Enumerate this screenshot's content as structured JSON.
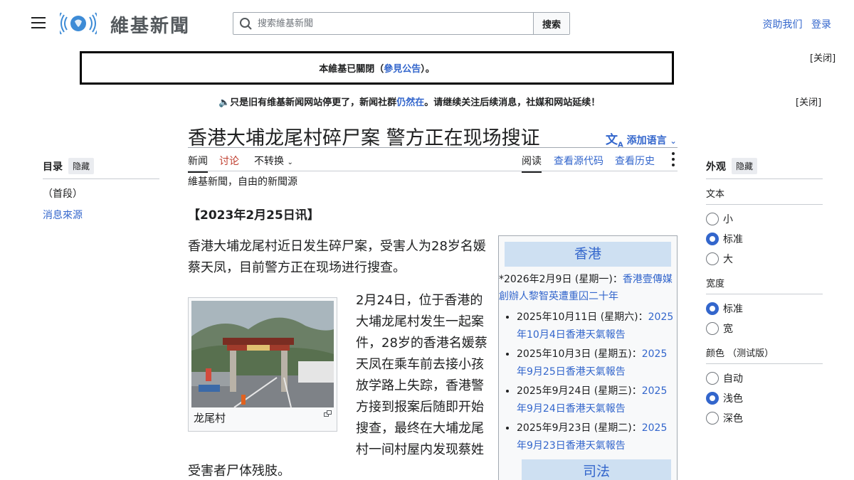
{
  "header": {
    "wordmark": "維基新聞",
    "search_placeholder": "搜索維基新聞",
    "search_button": "搜索",
    "donate": "资助我们",
    "login": "登录"
  },
  "notices": {
    "closed_pre": "本維基已關閉（",
    "closed_link": "參見公告",
    "closed_post": "）。",
    "close1": "[关闭]",
    "notice2_pre": "🔈只是旧有维基新闻网站停更了，新闻社群",
    "notice2_link": "仍然在",
    "notice2_post": "。请继续关注后续消息，社媒和网站延续！",
    "close2": "[关闭]"
  },
  "article": {
    "title": "香港大埔龙尾村碎尸案 警方正在现场搜证",
    "add_language": "添加语言",
    "tabs": {
      "news": "新闻",
      "talk": "讨论",
      "variant": "不转换",
      "read": "阅读",
      "view_source": "查看源代码",
      "view_history": "查看历史"
    },
    "tagline": "維基新聞，自由的新聞源",
    "dateline": "【2023年2月25日讯】",
    "para1": "香港大埔龙尾村近日发生碎尸案，受害人为28岁名媛蔡天凤，目前警方正在现场进行搜查。",
    "para2": "2月24日，位于香港的大埔龙尾村发生一起案件，28岁的香港名媛蔡天凤在乘车前去接小孩放学路上失踪，香港警方接到报案后随即开始搜查，最终在大埔龙尾村一间村屋内发现蔡姓受害者尸体残肢。",
    "thumb_caption": "龙尾村"
  },
  "infobox": {
    "heading": "香港",
    "lead_pre": "*2026年2月9日 (星期一)：",
    "lead_link": "香港壹傳媒創辦人黎智英遭重囚二十年",
    "items": [
      {
        "date": "2025年10月11日 (星期六)：",
        "link": "2025年10月4日香港天氣報告"
      },
      {
        "date": "2025年10月3日 (星期五)：",
        "link": "2025年9月25日香港天氣報告"
      },
      {
        "date": "2025年9月24日 (星期三)：",
        "link": "2025年9月24日香港天氣報告"
      },
      {
        "date": "2025年9月23日 (星期二)：",
        "link": "2025年9月23日香港天氣報告"
      }
    ],
    "heading2": "司法"
  },
  "toc": {
    "title": "目录",
    "hide": "隐藏",
    "items": [
      "（首段）",
      "消息來源"
    ]
  },
  "appearance": {
    "title": "外观",
    "hide": "隐藏",
    "text_label": "文本",
    "text_options": [
      "小",
      "标准",
      "大"
    ],
    "text_selected": "标准",
    "width_label": "宽度",
    "width_options": [
      "标准",
      "宽"
    ],
    "width_selected": "标准",
    "color_label": "颜色 （测试版）",
    "color_options": [
      "自动",
      "浅色",
      "深色"
    ],
    "color_selected": "浅色"
  }
}
